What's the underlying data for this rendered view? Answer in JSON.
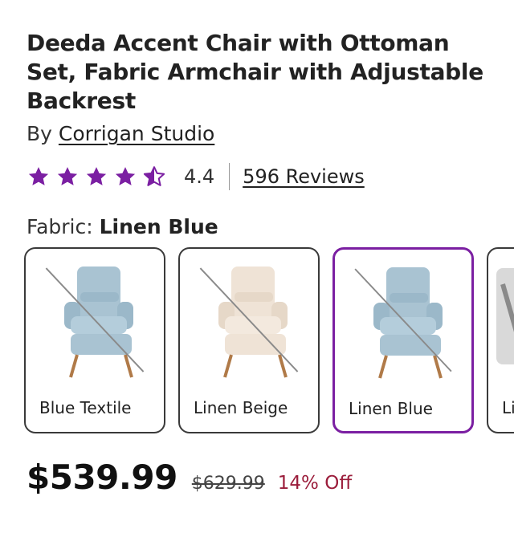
{
  "product": {
    "title": "Deeda Accent Chair with Ottoman Set, Fabric Armchair with Adjustable Backrest",
    "by_prefix": "By",
    "brand": "Corrigan Studio"
  },
  "rating": {
    "value": "4.4",
    "stars_filled_fraction": 0.88,
    "reviews_label": "596 Reviews",
    "star_color": "#7b1fa2"
  },
  "fabric": {
    "label": "Fabric:",
    "selected": "Linen Blue",
    "options": [
      {
        "label": "Blue Textile",
        "color": "#a9c3d2",
        "unavailable": true
      },
      {
        "label": "Linen Beige",
        "color": "#efe3d6",
        "unavailable": true
      },
      {
        "label": "Linen Blue",
        "color": "#a9c3d2",
        "unavailable": true
      },
      {
        "label": "Li",
        "color": "#9a9a9a",
        "unavailable": false
      }
    ]
  },
  "pricing": {
    "price": "$539.99",
    "original_price": "$629.99",
    "discount": "14% Off"
  }
}
